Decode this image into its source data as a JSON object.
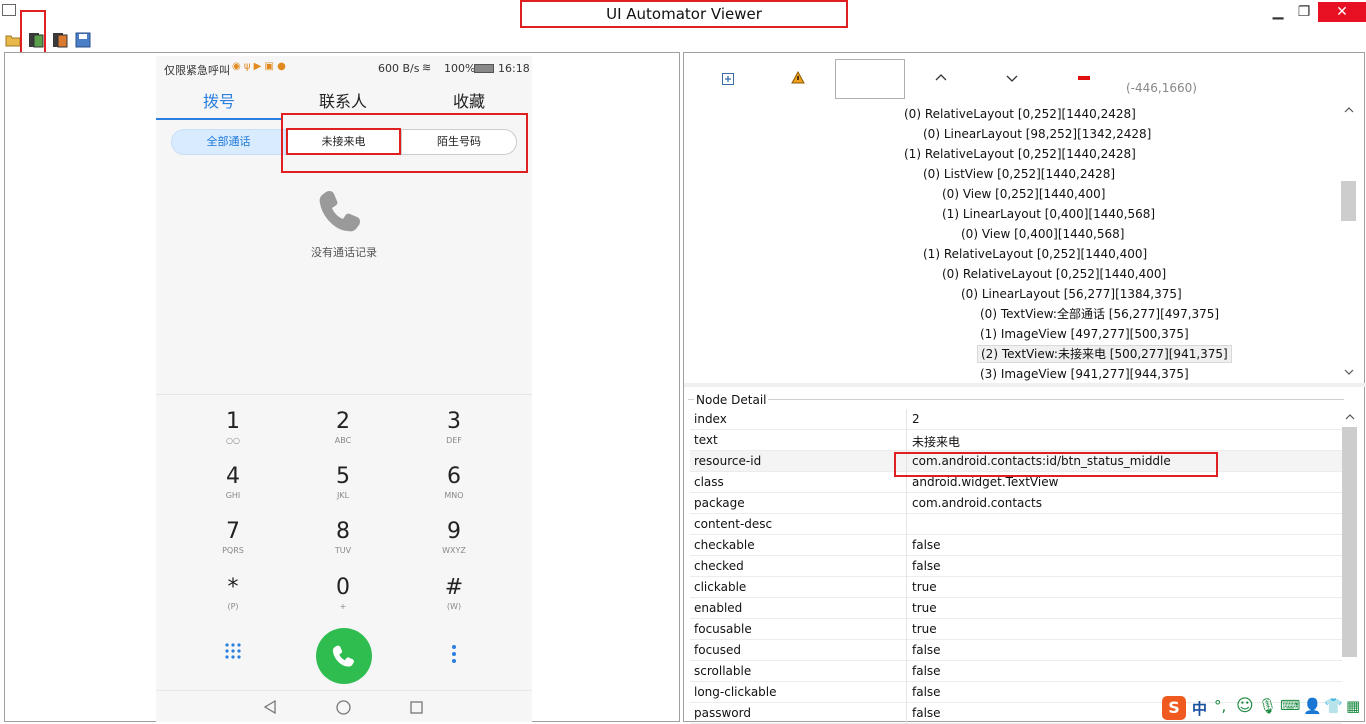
{
  "window": {
    "title": "UI Automator Viewer",
    "minimize_glyph": "▁",
    "restore_glyph": "❐",
    "close_glyph": "✕"
  },
  "toolbar": {
    "icons": [
      "open-folder-icon",
      "device-screenshot-icon",
      "device-screenshot-compressed-icon",
      "save-icon"
    ]
  },
  "phone": {
    "status_left": "仅限紧急呼叫",
    "status_right": "600 B/s",
    "battery": "100%",
    "time": "16:18",
    "tabs": [
      "拨号",
      "联系人",
      "收藏"
    ],
    "segments": [
      "全部通话",
      "未接来电",
      "陌生号码"
    ],
    "empty_text": "没有通话记录",
    "keys": [
      {
        "d": "1",
        "l": "○○"
      },
      {
        "d": "2",
        "l": "ABC"
      },
      {
        "d": "3",
        "l": "DEF"
      },
      {
        "d": "4",
        "l": "GHI"
      },
      {
        "d": "5",
        "l": "JKL"
      },
      {
        "d": "6",
        "l": "MNO"
      },
      {
        "d": "7",
        "l": "PQRS"
      },
      {
        "d": "8",
        "l": "TUV"
      },
      {
        "d": "9",
        "l": "WXYZ"
      },
      {
        "d": "*",
        "l": "(P)"
      },
      {
        "d": "0",
        "l": "+"
      },
      {
        "d": "#",
        "l": "(W)"
      }
    ]
  },
  "right_toolbar": {
    "coords": "(-446,1660)"
  },
  "tree": [
    "(0) RelativeLayout [0,252][1440,2428]",
    "(0) LinearLayout [98,252][1342,2428]",
    "(1) RelativeLayout [0,252][1440,2428]",
    "(0) ListView [0,252][1440,2428]",
    "(0) View [0,252][1440,400]",
    "(1) LinearLayout [0,400][1440,568]",
    "(0) View [0,400][1440,568]",
    "(1) RelativeLayout [0,252][1440,400]",
    "(0) RelativeLayout [0,252][1440,400]",
    "(0) LinearLayout [56,277][1384,375]",
    "(0) TextView:全部通话 [56,277][497,375]",
    "(1) ImageView [497,277][500,375]",
    "(2) TextView:未接来电 [500,277][941,375]",
    "(3) ImageView [941,277][944,375]"
  ],
  "detail": {
    "title": "Node Detail",
    "rows": [
      {
        "k": "index",
        "v": "2"
      },
      {
        "k": "text",
        "v": "未接来电"
      },
      {
        "k": "resource-id",
        "v": "com.android.contacts:id/btn_status_middle"
      },
      {
        "k": "class",
        "v": "android.widget.TextView"
      },
      {
        "k": "package",
        "v": "com.android.contacts"
      },
      {
        "k": "content-desc",
        "v": ""
      },
      {
        "k": "checkable",
        "v": "false"
      },
      {
        "k": "checked",
        "v": "false"
      },
      {
        "k": "clickable",
        "v": "true"
      },
      {
        "k": "enabled",
        "v": "true"
      },
      {
        "k": "focusable",
        "v": "true"
      },
      {
        "k": "focused",
        "v": "false"
      },
      {
        "k": "scrollable",
        "v": "false"
      },
      {
        "k": "long-clickable",
        "v": "false"
      },
      {
        "k": "password",
        "v": "false"
      }
    ]
  },
  "ime": {
    "label": "中"
  },
  "colors": {
    "highlight": "#e02020",
    "accent": "#2a7fdf",
    "call": "#2ebd4e"
  }
}
